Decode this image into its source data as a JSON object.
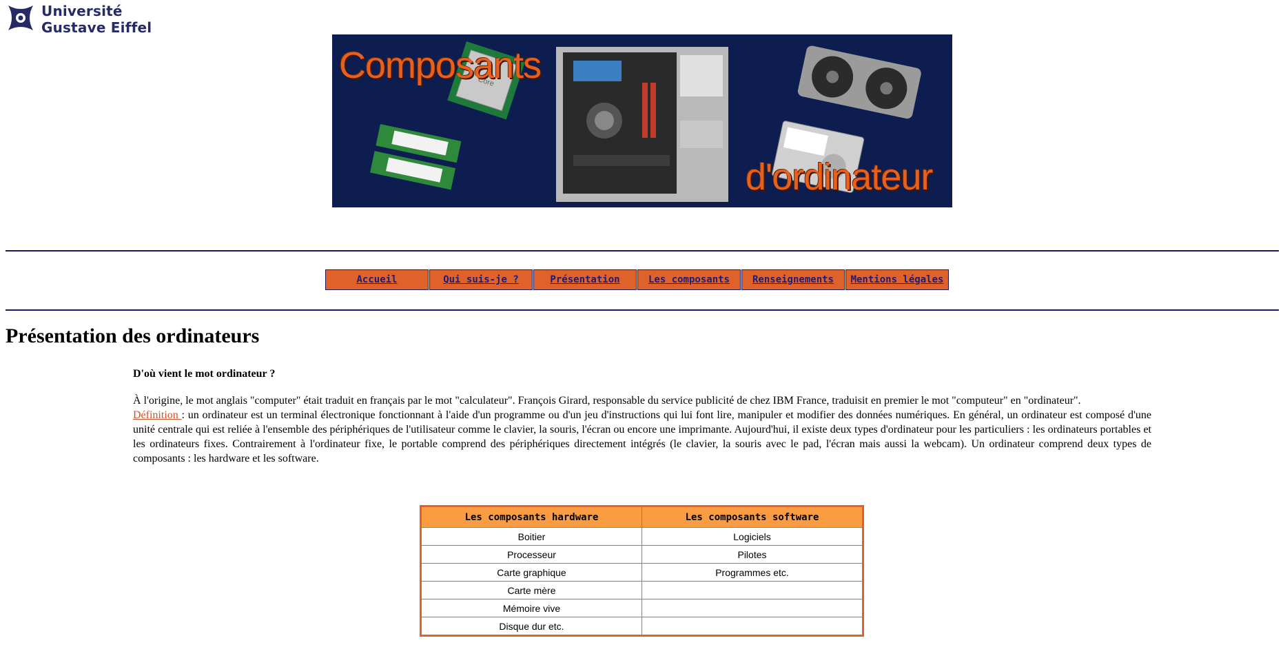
{
  "logo": {
    "line1": "Université",
    "line2": "Gustave Eiffel",
    "color": "#262b63"
  },
  "banner": {
    "title_left": "Composants",
    "title_right": "d'ordinateur",
    "background": "#0d1d4f",
    "accent": "#e8601c"
  },
  "nav": {
    "items": [
      {
        "label": "Accueil"
      },
      {
        "label": "Qui suis-je ?"
      },
      {
        "label": "Présentation"
      },
      {
        "label": "Les composants"
      },
      {
        "label": "Renseignements"
      },
      {
        "label": "Mentions légales"
      }
    ],
    "background": "#e0622b"
  },
  "page": {
    "title": "Présentation des ordinateurs",
    "subtitle": "D'où vient le mot ordinateur ?",
    "para1": "À l'origine, le mot anglais \"computer\" était traduit en français par le mot \"calculateur\". François Girard, responsable du service publicité de chez IBM France, traduisit en premier le mot \"computeur\" en \"ordinateur\".",
    "def_link": "Définition ",
    "para2": ": un ordinateur est un terminal électronique fonctionnant à l'aide d'un programme ou d'un jeu d'instructions qui lui font lire, manipuler et modifier des données numériques. En général, un ordinateur est composé d'une unité centrale qui est reliée à l'ensemble des périphériques de l'utilisateur comme le clavier, la souris, l'écran ou encore une imprimante. Aujourd'hui, il existe deux types d'ordinateur pour les particuliers : les ordinateurs portables et les ordinateurs fixes. Contrairement à l'ordinateur fixe, le portable comprend des périphériques directement intégrés (le clavier, la souris avec le pad, l'écran mais aussi la webcam). Un ordinateur comprend deux types de composants : les hardware et les software."
  },
  "table": {
    "headers": [
      "Les composants hardware",
      "Les composants software"
    ],
    "rows": [
      [
        "Boitier",
        "Logiciels"
      ],
      [
        "Processeur",
        "Pilotes"
      ],
      [
        "Carte graphique",
        "Programmes etc."
      ],
      [
        "Carte mère",
        ""
      ],
      [
        "Mémoire vive",
        ""
      ],
      [
        "Disque dur etc.",
        ""
      ]
    ]
  }
}
